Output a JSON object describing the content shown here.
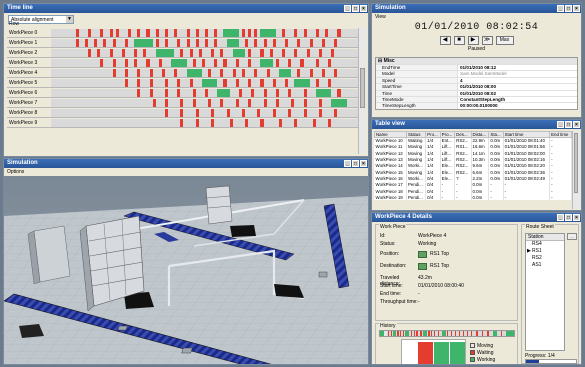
{
  "timeline": {
    "title": "Time line",
    "alignment": "Absolute alignment",
    "header_row": "Row",
    "rows": [
      {
        "label": "WorkPiece 0",
        "segs": [
          [
            8,
            1,
            "r"
          ],
          [
            12,
            1,
            "r"
          ],
          [
            16,
            1,
            "r"
          ],
          [
            19,
            1,
            "r"
          ],
          [
            21,
            1,
            "r"
          ],
          [
            25,
            1,
            "r"
          ],
          [
            28,
            1,
            "r"
          ],
          [
            31,
            1,
            "r"
          ],
          [
            34,
            1,
            "r"
          ],
          [
            37,
            1,
            "r"
          ],
          [
            40,
            1,
            "r"
          ],
          [
            44,
            1,
            "r"
          ],
          [
            47,
            1,
            "r"
          ],
          [
            50,
            1,
            "r"
          ],
          [
            53,
            1,
            "r"
          ],
          [
            56,
            5,
            "g"
          ],
          [
            62,
            1,
            "r"
          ],
          [
            64,
            1,
            "r"
          ],
          [
            66,
            1,
            "r"
          ],
          [
            68,
            5,
            "g"
          ],
          [
            75,
            1,
            "r"
          ],
          [
            79,
            1,
            "r"
          ],
          [
            82,
            1,
            "r"
          ],
          [
            86,
            1,
            "r"
          ],
          [
            89,
            1,
            "r"
          ],
          [
            93,
            1,
            "r"
          ]
        ]
      },
      {
        "label": "WorkPiece 1",
        "segs": [
          [
            8,
            1,
            "r"
          ],
          [
            11,
            1,
            "r"
          ],
          [
            14,
            1,
            "r"
          ],
          [
            17,
            1,
            "r"
          ],
          [
            20,
            1,
            "r"
          ],
          [
            24,
            1,
            "r"
          ],
          [
            27,
            6,
            "g"
          ],
          [
            34,
            1,
            "r"
          ],
          [
            37,
            1,
            "r"
          ],
          [
            41,
            1,
            "r"
          ],
          [
            44,
            1,
            "r"
          ],
          [
            47,
            1,
            "r"
          ],
          [
            50,
            1,
            "r"
          ],
          [
            53,
            1,
            "r"
          ],
          [
            57,
            4,
            "g"
          ],
          [
            63,
            1,
            "r"
          ],
          [
            66,
            1,
            "r"
          ],
          [
            69,
            1,
            "r"
          ],
          [
            72,
            1,
            "r"
          ],
          [
            76,
            1,
            "r"
          ],
          [
            80,
            1,
            "r"
          ],
          [
            84,
            1,
            "r"
          ],
          [
            88,
            1,
            "r"
          ],
          [
            92,
            1,
            "r"
          ]
        ]
      },
      {
        "label": "WorkPiece 2",
        "segs": [
          [
            12,
            1,
            "r"
          ],
          [
            15,
            1,
            "r"
          ],
          [
            19,
            1,
            "r"
          ],
          [
            23,
            1,
            "r"
          ],
          [
            27,
            1,
            "r"
          ],
          [
            30,
            1,
            "r"
          ],
          [
            34,
            6,
            "g"
          ],
          [
            42,
            1,
            "r"
          ],
          [
            45,
            1,
            "r"
          ],
          [
            48,
            1,
            "r"
          ],
          [
            52,
            1,
            "r"
          ],
          [
            55,
            1,
            "r"
          ],
          [
            59,
            4,
            "g"
          ],
          [
            64,
            1,
            "r"
          ],
          [
            68,
            1,
            "r"
          ],
          [
            71,
            1,
            "r"
          ],
          [
            75,
            1,
            "r"
          ],
          [
            79,
            1,
            "r"
          ],
          [
            83,
            1,
            "r"
          ],
          [
            87,
            1,
            "r"
          ],
          [
            91,
            1,
            "r"
          ]
        ]
      },
      {
        "label": "WorkPiece 3",
        "segs": [
          [
            16,
            1,
            "r"
          ],
          [
            20,
            1,
            "r"
          ],
          [
            24,
            1,
            "r"
          ],
          [
            27,
            1,
            "r"
          ],
          [
            31,
            1,
            "r"
          ],
          [
            35,
            1,
            "r"
          ],
          [
            39,
            5,
            "g"
          ],
          [
            46,
            1,
            "r"
          ],
          [
            49,
            1,
            "r"
          ],
          [
            53,
            1,
            "r"
          ],
          [
            56,
            1,
            "r"
          ],
          [
            60,
            1,
            "r"
          ],
          [
            64,
            1,
            "r"
          ],
          [
            68,
            4,
            "g"
          ],
          [
            73,
            1,
            "r"
          ],
          [
            77,
            1,
            "r"
          ],
          [
            81,
            1,
            "r"
          ],
          [
            86,
            1,
            "r"
          ],
          [
            90,
            1,
            "r"
          ]
        ]
      },
      {
        "label": "WorkPiece 4",
        "segs": [
          [
            20,
            1,
            "r"
          ],
          [
            24,
            1,
            "r"
          ],
          [
            28,
            1,
            "r"
          ],
          [
            32,
            1,
            "r"
          ],
          [
            36,
            1,
            "r"
          ],
          [
            40,
            1,
            "r"
          ],
          [
            44,
            5,
            "g"
          ],
          [
            51,
            1,
            "r"
          ],
          [
            55,
            1,
            "r"
          ],
          [
            59,
            1,
            "r"
          ],
          [
            62,
            1,
            "r"
          ],
          [
            66,
            1,
            "r"
          ],
          [
            70,
            1,
            "r"
          ],
          [
            74,
            4,
            "g"
          ],
          [
            80,
            1,
            "r"
          ],
          [
            84,
            1,
            "r"
          ],
          [
            88,
            1,
            "r"
          ],
          [
            92,
            1,
            "r"
          ]
        ]
      },
      {
        "label": "WorkPiece 5",
        "segs": [
          [
            24,
            1,
            "r"
          ],
          [
            28,
            1,
            "r"
          ],
          [
            32,
            1,
            "r"
          ],
          [
            37,
            1,
            "r"
          ],
          [
            41,
            1,
            "r"
          ],
          [
            45,
            1,
            "r"
          ],
          [
            49,
            5,
            "g"
          ],
          [
            56,
            1,
            "r"
          ],
          [
            60,
            1,
            "r"
          ],
          [
            64,
            1,
            "r"
          ],
          [
            68,
            1,
            "r"
          ],
          [
            72,
            1,
            "r"
          ],
          [
            76,
            1,
            "r"
          ],
          [
            79,
            5,
            "g"
          ],
          [
            86,
            1,
            "r"
          ],
          [
            90,
            1,
            "r"
          ]
        ]
      },
      {
        "label": "WorkPiece 6",
        "segs": [
          [
            28,
            1,
            "r"
          ],
          [
            32,
            1,
            "r"
          ],
          [
            37,
            1,
            "r"
          ],
          [
            41,
            1,
            "r"
          ],
          [
            46,
            1,
            "r"
          ],
          [
            50,
            1,
            "r"
          ],
          [
            54,
            4,
            "g"
          ],
          [
            61,
            1,
            "r"
          ],
          [
            65,
            1,
            "r"
          ],
          [
            69,
            1,
            "r"
          ],
          [
            73,
            1,
            "r"
          ],
          [
            77,
            1,
            "r"
          ],
          [
            82,
            1,
            "r"
          ],
          [
            86,
            5,
            "g"
          ],
          [
            93,
            1,
            "r"
          ]
        ]
      },
      {
        "label": "WorkPiece 7",
        "segs": [
          [
            33,
            1,
            "r"
          ],
          [
            37,
            1,
            "r"
          ],
          [
            42,
            1,
            "r"
          ],
          [
            46,
            1,
            "r"
          ],
          [
            51,
            1,
            "r"
          ],
          [
            55,
            1,
            "r"
          ],
          [
            60,
            1,
            "r"
          ],
          [
            64,
            1,
            "r"
          ],
          [
            69,
            1,
            "r"
          ],
          [
            73,
            1,
            "r"
          ],
          [
            78,
            1,
            "r"
          ],
          [
            82,
            1,
            "r"
          ],
          [
            87,
            1,
            "r"
          ],
          [
            91,
            5,
            "g"
          ]
        ]
      },
      {
        "label": "WorkPiece 8",
        "segs": [
          [
            37,
            1,
            "r"
          ],
          [
            42,
            1,
            "r"
          ],
          [
            47,
            1,
            "r"
          ],
          [
            52,
            1,
            "r"
          ],
          [
            57,
            1,
            "r"
          ],
          [
            62,
            1,
            "r"
          ],
          [
            67,
            1,
            "r"
          ],
          [
            72,
            1,
            "r"
          ],
          [
            77,
            1,
            "r"
          ],
          [
            82,
            1,
            "r"
          ],
          [
            87,
            1,
            "r"
          ],
          [
            92,
            1,
            "r"
          ]
        ]
      },
      {
        "label": "WorkPiece 9",
        "segs": [
          [
            42,
            1,
            "r"
          ],
          [
            47,
            1,
            "r"
          ],
          [
            52,
            1,
            "r"
          ],
          [
            58,
            1,
            "r"
          ],
          [
            63,
            1,
            "r"
          ],
          [
            68,
            1,
            "r"
          ],
          [
            74,
            1,
            "r"
          ],
          [
            79,
            1,
            "r"
          ],
          [
            85,
            1,
            "r"
          ],
          [
            90,
            1,
            "r"
          ]
        ]
      }
    ]
  },
  "simulation": {
    "title": "Simulation",
    "menu": "View",
    "clock": "01/01/2010  08:02:54",
    "controls": [
      "◀",
      "■",
      "▶",
      "≫",
      "Max"
    ],
    "status": "Paused",
    "group": "Misc",
    "props": [
      {
        "k": "EndTime",
        "v": "01/01/2010 08:12",
        "gray": false
      },
      {
        "k": "Model",
        "v": "Sam.Model.SamModel",
        "gray": true
      },
      {
        "k": "Speed",
        "v": "4",
        "gray": false
      },
      {
        "k": "StartTime",
        "v": "01/01/2010 08:00",
        "gray": false
      },
      {
        "k": "Time",
        "v": "01/01/2010 08:02",
        "gray": false
      },
      {
        "k": "TimeMode",
        "v": "ConstantStepLength",
        "gray": false
      },
      {
        "k": "TimeStepLength",
        "v": "00:00:00.0100000",
        "gray": false
      }
    ]
  },
  "table_view": {
    "title": "Table view",
    "headers": [
      "Name",
      "Status",
      "Pro...",
      "Pro...",
      "Des...",
      "Dista...",
      "Sta...",
      "Start time",
      "End time"
    ],
    "rows": [
      [
        "WorkPiece 10",
        "Waiting",
        "1/4",
        "Ent...",
        "RS2...",
        "22.9m",
        "0.0m",
        "01/01/2010 08:01:40",
        "-"
      ],
      [
        "WorkPiece 11",
        "Moving",
        "1/4",
        "Lift...",
        "RS1...",
        "16.6m",
        "0.0m",
        "01/01/2010 08:01:56",
        "-"
      ],
      [
        "WorkPiece 12",
        "Moving",
        "1/4",
        "Lift...",
        "RS2...",
        "14.1m",
        "0.0m",
        "01/01/2010 08:02:00",
        "-"
      ],
      [
        "WorkPiece 13",
        "Moving",
        "1/4",
        "Lift...",
        "RS2...",
        "10.3m",
        "0.0m",
        "01/01/2010 08:02:16",
        "-"
      ],
      [
        "WorkPiece 14",
        "Worki...",
        "1/4",
        "Ele...",
        "RS2...",
        "9.6m",
        "0.0m",
        "01/01/2010 08:02:20",
        "-"
      ],
      [
        "WorkPiece 15",
        "Moving",
        "1/4",
        "Ele...",
        "RS2...",
        "6.6m",
        "0.0m",
        "01/01/2010 08:02:36",
        "-"
      ],
      [
        "WorkPiece 16",
        "Worki...",
        "0/4",
        "Ele...",
        "?",
        "2.2m",
        "0.0m",
        "01/01/2010 08:02:49",
        "-"
      ],
      [
        "WorkPiece 17",
        "Pendi...",
        "0/4",
        "-",
        "-",
        "0.0m",
        "-",
        "-",
        "-"
      ],
      [
        "WorkPiece 18",
        "Pendi...",
        "0/4",
        "-",
        "-",
        "0.0m",
        "-",
        "-",
        "-"
      ],
      [
        "WorkPiece 19",
        "Pendi...",
        "0/4",
        "-",
        "-",
        "0.0m",
        "-",
        "-",
        "-"
      ]
    ]
  },
  "details": {
    "title": "WorkPiece 4 Details",
    "group": "Work Piece",
    "id_label": "Id:",
    "id_value": "WorkPiece 4",
    "status_label": "Status:",
    "status_value": "Working",
    "position_label": "Position:",
    "position_value": "RS1 Top",
    "destination_label": "Destination:",
    "destination_value": "RS1 Top",
    "traveled_label": "Traveled distance:",
    "traveled_value": "43.2m",
    "start_label": "Start time:",
    "start_value": "01/01/2010 08:00:40",
    "end_label": "End time:",
    "end_value": "-",
    "throughput_label": "Throughput time:",
    "throughput_value": "-",
    "route_title": "Route Sheet",
    "route_header": "Station",
    "route_items": [
      "RS4",
      "RS1",
      "RS2",
      "AS1"
    ],
    "route_current": 1,
    "add_label": "...",
    "progress_label": "Progress:",
    "progress_value": "1/4",
    "progress_fraction": 0.25,
    "history_title": "History",
    "history_legend": [
      "Moving",
      "Waiting",
      "Working"
    ],
    "history_bars": [
      0.0,
      0.9,
      0.9,
      0.9
    ],
    "colors": {
      "moving": "#e8e8e8",
      "waiting": "#e53c30",
      "working": "#3fb56b"
    }
  },
  "view3d": {
    "title": "Simulation",
    "menu": "Options"
  },
  "colors": {
    "titlebar": "#2a5598",
    "red": "#e53c30",
    "green": "#3fb56b",
    "conveyor": "#1a2a8a"
  }
}
